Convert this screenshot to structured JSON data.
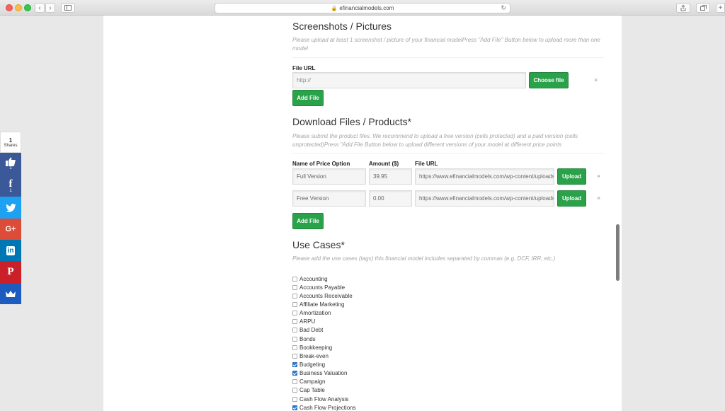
{
  "browser": {
    "url": "efinancialmodels.com"
  },
  "screenshots": {
    "title": "Screenshots / Pictures",
    "help": "Please upload at least 1 screenshot / picture of your financial modelPress \"Add File\" Button below to upload more than one model",
    "file_url_label": "File URL",
    "file_url_placeholder": "http://",
    "choose_label": "Choose file",
    "add_label": "Add File",
    "remove": "×"
  },
  "downloads": {
    "title": "Download Files / Products*",
    "help": "Please submit the product files. We recommend to upload a free version (cells protected) and a paid version (cells unprotected)Press \"Add File Button below to upload different versions of your model at different price points",
    "col_name": "Name of Price Option",
    "col_amount": "Amount ($)",
    "col_url": "File URL",
    "rows": [
      {
        "name": "Full Version",
        "amount": "39.95",
        "url": "https://www.efinancialmodels.com/wp-content/uploads",
        "upload": "Upload",
        "remove": "×"
      },
      {
        "name": "Free Version",
        "amount": "0.00",
        "url": "https://www.efinancialmodels.com/wp-content/uploads",
        "upload": "Upload",
        "remove": "×"
      }
    ],
    "add_label": "Add File"
  },
  "usecases": {
    "title": "Use Cases*",
    "help": "Please add the use cases (tags) this financial model includes separated by commas (e.g. DCF, IRR, etc.)",
    "items": [
      {
        "label": "Accounting",
        "checked": false
      },
      {
        "label": "Accounts Payable",
        "checked": false
      },
      {
        "label": "Accounts Receivable",
        "checked": false
      },
      {
        "label": "Affiliate Marketing",
        "checked": false
      },
      {
        "label": "Amortization",
        "checked": false
      },
      {
        "label": "ARPU",
        "checked": false
      },
      {
        "label": "Bad Debt",
        "checked": false
      },
      {
        "label": "Bonds",
        "checked": false
      },
      {
        "label": "Bookkeeping",
        "checked": false
      },
      {
        "label": "Break-even",
        "checked": false
      },
      {
        "label": "Budgeting",
        "checked": true
      },
      {
        "label": "Business Valuation",
        "checked": true
      },
      {
        "label": "Campaign",
        "checked": false
      },
      {
        "label": "Cap Table",
        "checked": false
      },
      {
        "label": "Cash Flow Analysis",
        "checked": false
      },
      {
        "label": "Cash Flow Projections",
        "checked": true
      }
    ]
  },
  "share": {
    "count": "1",
    "count_label": "Shares",
    "like_count": "1",
    "fb_count": "1",
    "colors": {
      "like": "#3b5998",
      "facebook": "#3b5998",
      "twitter": "#1da1f2",
      "google": "#dd4b39",
      "linkedin": "#0077b5",
      "pinterest": "#cb2027",
      "crown": "#1e5bbf"
    }
  }
}
